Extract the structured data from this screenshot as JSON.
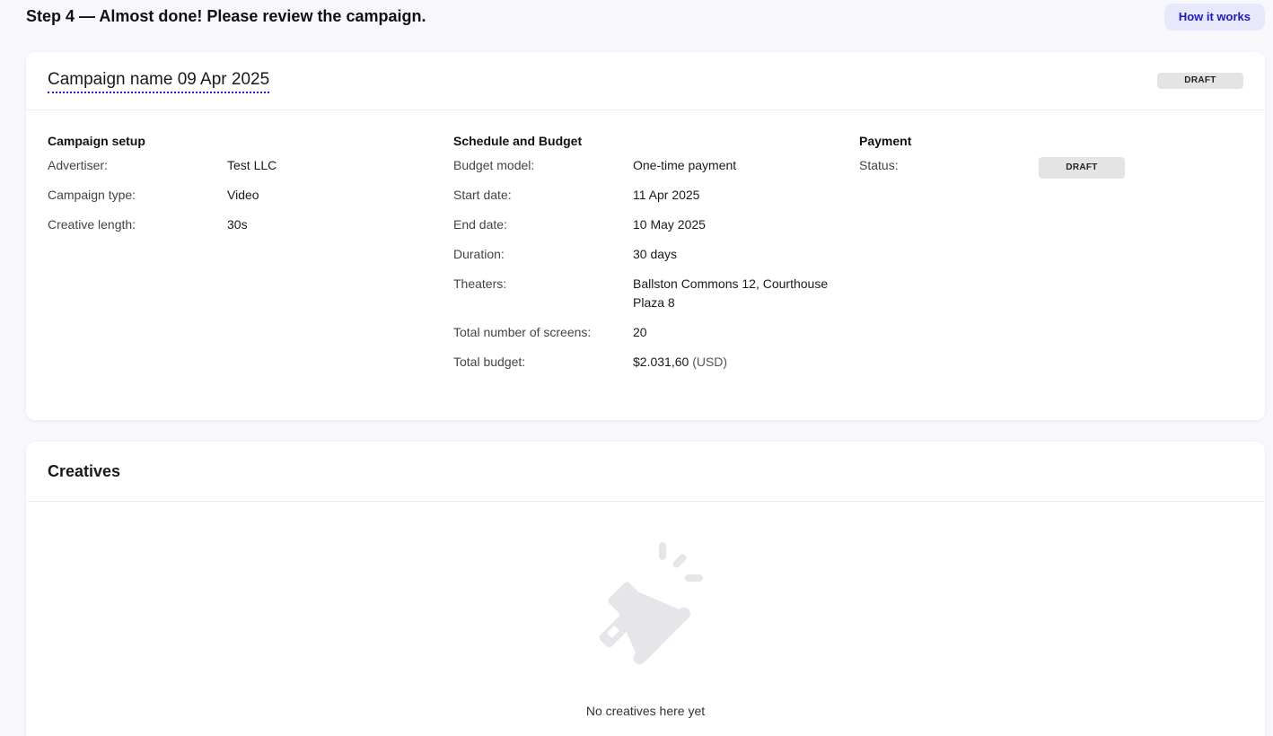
{
  "header": {
    "step_title": "Step 4 — Almost done! Please review the campaign.",
    "how_it_works": "How it works"
  },
  "summary": {
    "campaign_name": "Campaign name 09 Apr 2025",
    "status_badge": "DRAFT",
    "setup": {
      "title": "Campaign setup",
      "rows": [
        {
          "label": "Advertiser:",
          "value": "Test LLC"
        },
        {
          "label": "Campaign type:",
          "value": "Video"
        },
        {
          "label": "Creative length:",
          "value": "30s"
        }
      ]
    },
    "schedule": {
      "title": "Schedule and Budget",
      "rows": [
        {
          "label": "Budget model:",
          "value": "One-time payment"
        },
        {
          "label": "Start date:",
          "value": "11 Apr 2025"
        },
        {
          "label": "End date:",
          "value": "10 May 2025"
        },
        {
          "label": "Duration:",
          "value": "30 days"
        },
        {
          "label": "Theaters:",
          "value": "Ballston Commons 12, Courthouse Plaza 8"
        },
        {
          "label": "Total number of screens:",
          "value": "20"
        },
        {
          "label": "Total budget:",
          "value": "$2.031,60",
          "suffix": "(USD)"
        }
      ]
    },
    "payment": {
      "title": "Payment",
      "status_label": "Status:",
      "status_value": "DRAFT"
    }
  },
  "creatives": {
    "title": "Creatives",
    "empty_icon": "megaphone-icon",
    "empty_text": "No creatives here yet"
  }
}
